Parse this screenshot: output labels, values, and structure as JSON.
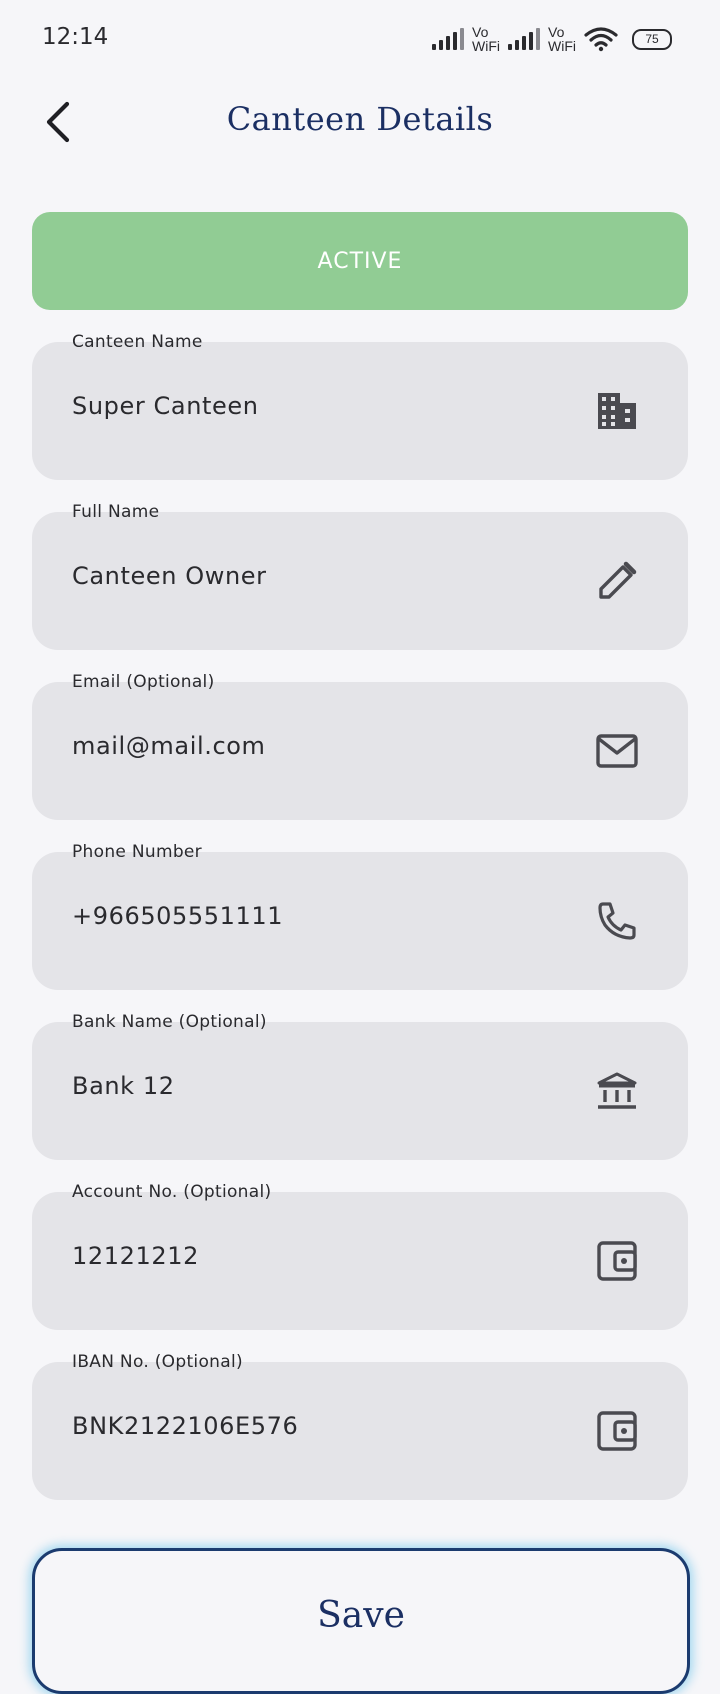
{
  "status_bar": {
    "time": "12:14",
    "vowifi_1": "Vo\nWiFi",
    "vowifi_2": "Vo\nWiFi",
    "battery": "75"
  },
  "header": {
    "title": "Canteen Details",
    "back_icon": "chevron-left-icon"
  },
  "status_banner": {
    "label": "ACTIVE",
    "color": "#91cc94"
  },
  "fields": [
    {
      "label": "Canteen Name",
      "value": "Super Canteen",
      "icon": "building-icon"
    },
    {
      "label": "Full Name",
      "value": "Canteen Owner",
      "icon": "pencil-icon"
    },
    {
      "label": "Email (Optional)",
      "value": "mail@mail.com",
      "icon": "mail-icon"
    },
    {
      "label": "Phone Number",
      "value": "+966505551111",
      "icon": "phone-icon"
    },
    {
      "label": "Bank Name (Optional)",
      "value": "Bank 12",
      "icon": "bank-icon"
    },
    {
      "label": "Account No. (Optional)",
      "value": "12121212",
      "icon": "wallet-icon"
    },
    {
      "label": "IBAN No. (Optional)",
      "value": "BNK2122106E576",
      "icon": "wallet-icon"
    }
  ],
  "save_button": {
    "label": "Save"
  },
  "colors": {
    "title": "#1b2f63",
    "field_bg": "#e4e4e8",
    "page_bg": "#f6f6f9",
    "save_border": "#1b3b6f",
    "save_glow": "#78c8eb"
  }
}
